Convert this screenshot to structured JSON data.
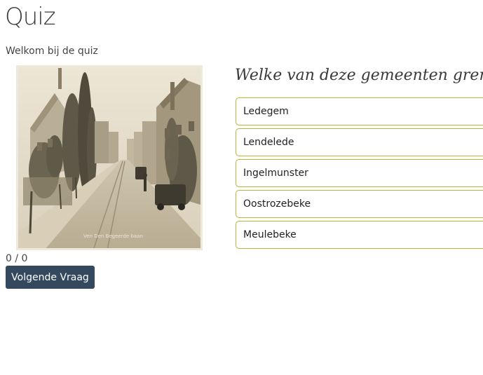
{
  "page": {
    "title": "Quiz",
    "intro": "Welkom bij de quiz"
  },
  "image": {
    "description_icon": "historic-street-photo",
    "caption": "Ven Den Begeerde baan"
  },
  "quiz": {
    "score": "0 / 0",
    "next_button_label": "Volgende Vraag",
    "question": "Welke van deze gemeenten grenst",
    "answers": [
      "Ledegem",
      "Lendelede",
      "Ingelmunster",
      "Oostrozebeke",
      "Meulebeke"
    ]
  },
  "colors": {
    "button_bg": "#34495e",
    "answer_border": "#b7b43a",
    "photo_sepia": "#d8cdb6"
  }
}
